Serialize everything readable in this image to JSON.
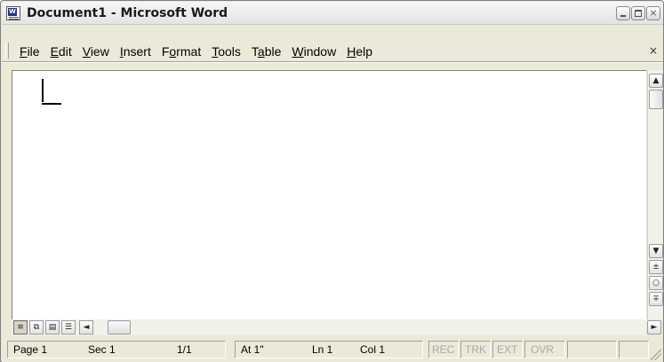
{
  "window": {
    "title": "Document1 - Microsoft Word",
    "app_icon_letter": "W"
  },
  "menu": {
    "items": [
      {
        "pre": "",
        "ul": "F",
        "post": "ile"
      },
      {
        "pre": "",
        "ul": "E",
        "post": "dit"
      },
      {
        "pre": "",
        "ul": "V",
        "post": "iew"
      },
      {
        "pre": "",
        "ul": "I",
        "post": "nsert"
      },
      {
        "pre": "F",
        "ul": "o",
        "post": "rmat"
      },
      {
        "pre": "",
        "ul": "T",
        "post": "ools"
      },
      {
        "pre": "T",
        "ul": "a",
        "post": "ble"
      },
      {
        "pre": "",
        "ul": "W",
        "post": "indow"
      },
      {
        "pre": "",
        "ul": "H",
        "post": "elp"
      }
    ],
    "doc_close": "×"
  },
  "scrollbar": {
    "up": "▲",
    "down": "▼",
    "prev_page": "±",
    "select_browse": "○",
    "next_page": "∓"
  },
  "viewbar": {
    "normal": "≡",
    "web": "⧉",
    "print": "▤",
    "outline": "☰",
    "left": "◄",
    "right": "►"
  },
  "status": {
    "page": "Page 1",
    "sec": "Sec 1",
    "pages": "1/1",
    "at": "At 1\"",
    "ln": "Ln 1",
    "col": "Col 1",
    "rec": "REC",
    "trk": "TRK",
    "ext": "EXT",
    "ovr": "OVR"
  }
}
